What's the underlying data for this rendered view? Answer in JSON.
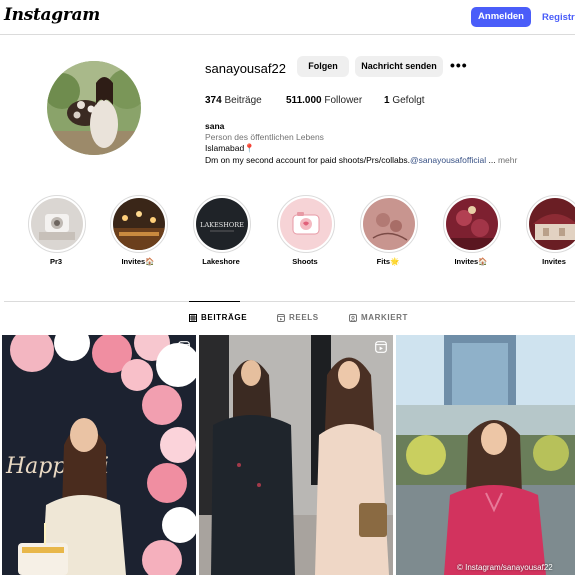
{
  "header": {
    "logo": "Instagram",
    "login_label": "Anmelden",
    "register_label": "Registrieren"
  },
  "profile": {
    "username": "sanayousaf22",
    "follow_label": "Folgen",
    "message_label": "Nachricht senden",
    "more_label": "•••",
    "posts_count": "374",
    "posts_label": "Beiträge",
    "followers_count": "511.000",
    "followers_label": "Follower",
    "following_count": "1",
    "following_label": "Gefolgt",
    "name": "sana",
    "category": "Person des öffentlichen Lebens",
    "location": "Islamabad📍",
    "bio": "Dm on my second account for paid shoots/Prs/collabs.",
    "mention": "@sanayousafofficial",
    "ellipsis": "...",
    "more_text": "mehr"
  },
  "highlights": [
    {
      "label": "Pr3",
      "icon": "camera-icon"
    },
    {
      "label": "Invites🏠",
      "icon": "venue-icon"
    },
    {
      "label": "Lakeshore",
      "icon": "lakeshore-logo",
      "logo_text": "LAKESHORE"
    },
    {
      "label": "Shoots",
      "icon": "camera-sticker-icon"
    },
    {
      "label": "Fits🌟",
      "icon": "flower-icon"
    },
    {
      "label": "Invites🏠",
      "icon": "flower-icon"
    },
    {
      "label": "Invites",
      "icon": "venue-icon"
    }
  ],
  "tabs": [
    {
      "label": "BEITRÄGE",
      "icon": "grid-icon",
      "active": true
    },
    {
      "label": "REELS",
      "icon": "reels-icon",
      "active": false
    },
    {
      "label": "MARKIERT",
      "icon": "tagged-icon",
      "active": false
    }
  ],
  "posts": [
    {
      "type": "reel",
      "overlay_text": "Happy Bi"
    },
    {
      "type": "reel"
    },
    {
      "type": "photo"
    }
  ],
  "watermark": "© Instagram/sanayousaf22",
  "colors": {
    "primary_button": "#4a5df9",
    "secondary_button": "#efefef",
    "link": "#385185",
    "muted_text": "#737373",
    "divider": "#dbdbdb"
  }
}
